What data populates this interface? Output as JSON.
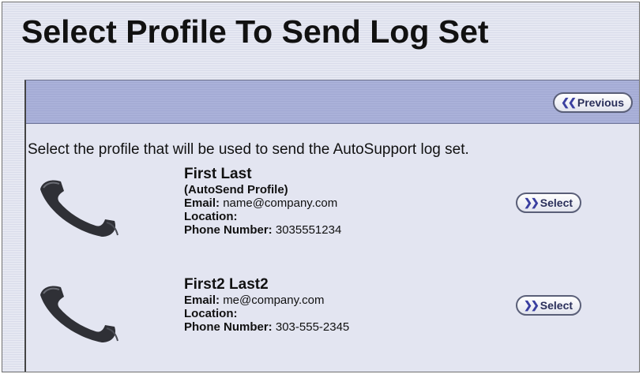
{
  "page": {
    "title": "Select Profile To Send Log Set"
  },
  "toolbar": {
    "previous_label": "Previous"
  },
  "instruction": "Select the profile that will be used to send the AutoSupport log set.",
  "labels": {
    "email": "Email:",
    "location": "Location:",
    "phone": "Phone Number:",
    "select": "Select"
  },
  "profiles": [
    {
      "name": "First Last",
      "tag": "(AutoSend Profile)",
      "email": "name@company.com",
      "location": "",
      "phone": "3035551234",
      "icon": "telephone-handset-icon"
    },
    {
      "name": "First2 Last2",
      "email": "me@company.com",
      "location": "",
      "phone": "303-555-2345",
      "icon": "telephone-handset-icon"
    }
  ],
  "colors": {
    "toolbar": "#a9b0d8",
    "panel": "#e3e5f1",
    "button_chevron": "#3a3fa0"
  }
}
